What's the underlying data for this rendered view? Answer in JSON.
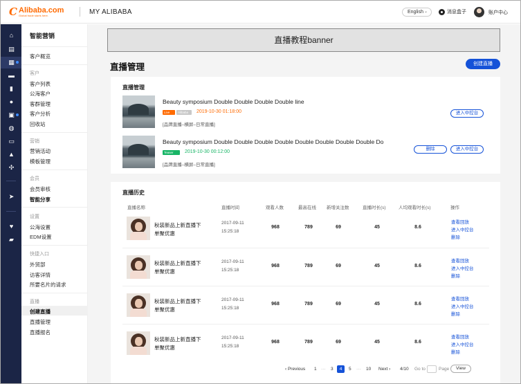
{
  "header": {
    "logo_word": "Alibaba.com",
    "logo_tagline": "Global trade starts here.",
    "title": "MY ALIBABA",
    "language": "English",
    "messages": "消息盒子",
    "account": "账户中心"
  },
  "sidebar_menu": {
    "title": "智能营销",
    "overview": "客户概览",
    "group_customers": "客户",
    "customer_list": "客户列表",
    "public_customers": "公海客户",
    "customer_groups": "客群管理",
    "customer_analysis": "客户分析",
    "recycle_bin": "回收站",
    "group_marketing": "营销",
    "marketing_activity": "营销活动",
    "template_management": "模板管理",
    "group_members": "会员",
    "member_review": "会员审核",
    "smart_sharing": "智能分享",
    "group_settings": "设置",
    "public_settings": "公海设置",
    "edm_settings": "EDM设置",
    "group_shortcuts": "快捷入口",
    "sales_dept": "外贸部",
    "visitor_details": "访客详情",
    "card_requests": "所要名片的请求",
    "group_live": "直播",
    "create_live": "创建直播",
    "live_management": "直播管理",
    "live_signup": "直播报名"
  },
  "main": {
    "banner": "直播教程banner",
    "page_title": "直播管理",
    "create_button": "创建直播",
    "live_section_title": "直播管理",
    "live_items": [
      {
        "name": "Beauty symposium Double Double  Double Double line",
        "tag": "Live",
        "tag2": "Alibaba",
        "date": "2019-10-30 01:18:00",
        "date_color": "#ff6a00",
        "sub": "[品牌直播–横屏–日常直播]",
        "enter_button": "进入中控台"
      },
      {
        "name": "Beauty symposium Double Double  Double Double Double Double Double Double Do",
        "tag": "Teaser",
        "date": "2019-10-30 00:12:00",
        "date_color": "#18b566",
        "sub": "[品牌直播–横屏–日常直播]",
        "delete_button": "删除",
        "enter_button": "进入中控台"
      }
    ],
    "history_section_title": "直播历史",
    "history_columns": [
      "直播名称",
      "直播时间",
      "观看人数",
      "最高在线",
      "新增关注数",
      "直播时长(s)",
      "人均观看时长(s)",
      "操作"
    ],
    "history_rows": [
      {
        "name_line1": "秋装新品上新直播下",
        "name_line2": "单聚优惠",
        "date": "2017-09-11",
        "time": "15:25:18",
        "viewers": "968",
        "peak": "789",
        "new_follows": "69",
        "duration": "45",
        "avg_watch": "8.6",
        "op_replay": "查看回放",
        "op_console": "进入中控台",
        "op_delete": "删除"
      },
      {
        "name_line1": "秋装新品上新直播下",
        "name_line2": "单聚优惠",
        "date": "2017-09-11",
        "time": "15:25:18",
        "viewers": "968",
        "peak": "789",
        "new_follows": "69",
        "duration": "45",
        "avg_watch": "8.6",
        "op_replay": "查看回放",
        "op_console": "进入中控台",
        "op_delete": "删除"
      },
      {
        "name_line1": "秋装新品上新直播下",
        "name_line2": "单聚优惠",
        "date": "2017-09-11",
        "time": "15:25:18",
        "viewers": "968",
        "peak": "789",
        "new_follows": "69",
        "duration": "45",
        "avg_watch": "8.6",
        "op_replay": "查看回放",
        "op_console": "进入中控台",
        "op_delete": "删除"
      },
      {
        "name_line1": "秋装新品上新直播下",
        "name_line2": "单聚优惠",
        "date": "2017-09-11",
        "time": "15:25:18",
        "viewers": "968",
        "peak": "789",
        "new_follows": "69",
        "duration": "45",
        "avg_watch": "8.6",
        "op_replay": "查看回放",
        "op_console": "进入中控台",
        "op_delete": "删除"
      }
    ],
    "pagination": {
      "previous": "‹ Previous",
      "p1": "1",
      "ellipsis1": "···",
      "p3": "3",
      "current": "4",
      "p5": "5",
      "ellipsis2": "···",
      "p10": "10",
      "next": "Next ›",
      "page_info": "4/10",
      "goto": "Go to",
      "page": "Page",
      "view": "View"
    }
  }
}
